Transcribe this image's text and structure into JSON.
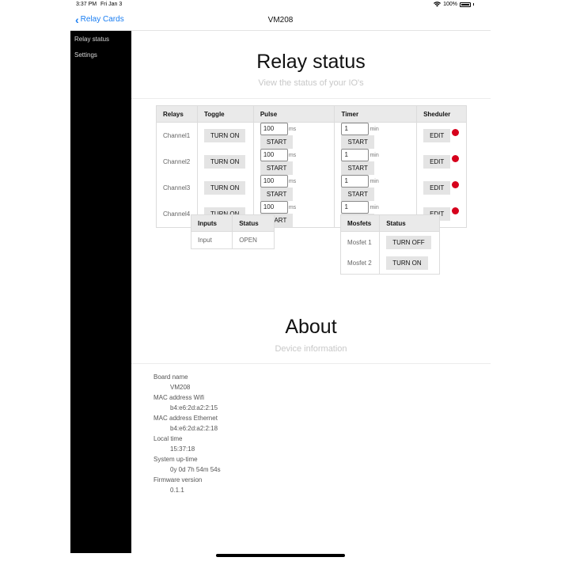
{
  "statusbar": {
    "time": "3:37 PM",
    "date": "Fri Jan 3",
    "battery": "100%"
  },
  "nav": {
    "back_label": "Relay Cards",
    "title": "VM208"
  },
  "sidebar": {
    "items": [
      {
        "label": "Relay status"
      },
      {
        "label": "Settings"
      }
    ]
  },
  "relay_section": {
    "title": "Relay status",
    "subtitle": "View the status of your IO's"
  },
  "relay_table": {
    "headers": [
      "Relays",
      "Toggle",
      "Pulse",
      "Timer",
      "Sheduler"
    ],
    "pulse_unit": "ms",
    "timer_unit": "min",
    "start_label": "START",
    "edit_label": "EDIT",
    "rows": [
      {
        "name": "Channel1",
        "toggle": "TURN ON",
        "pulse": "100",
        "timer": "1"
      },
      {
        "name": "Channel2",
        "toggle": "TURN ON",
        "pulse": "100",
        "timer": "1"
      },
      {
        "name": "Channel3",
        "toggle": "TURN ON",
        "pulse": "100",
        "timer": "1"
      },
      {
        "name": "Channel4",
        "toggle": "TURN ON",
        "pulse": "100",
        "timer": "1"
      }
    ],
    "scheduler_status_color": "#d6001c"
  },
  "inputs_table": {
    "headers": [
      "Inputs",
      "Status"
    ],
    "rows": [
      {
        "name": "Input",
        "status": "OPEN"
      }
    ]
  },
  "mosfets_table": {
    "headers": [
      "Mosfets",
      "Status"
    ],
    "rows": [
      {
        "name": "Mosfet 1",
        "action": "TURN OFF"
      },
      {
        "name": "Mosfet 2",
        "action": "TURN ON"
      }
    ]
  },
  "about_section": {
    "title": "About",
    "subtitle": "Device information",
    "items": [
      {
        "label": "Board name",
        "value": "VM208"
      },
      {
        "label": "MAC address Wifi",
        "value": "b4:e6:2d:a2:2:15"
      },
      {
        "label": "MAC address Ethernet",
        "value": "b4:e6:2d:a2:2:18"
      },
      {
        "label": "Local time",
        "value": "15:37:18"
      },
      {
        "label": "System up-time",
        "value": "0y 0d 7h 54m 54s"
      },
      {
        "label": "Firmware version",
        "value": "0.1.1"
      }
    ]
  },
  "colors": {
    "accent": "#1a7ef2",
    "sidebar_bg": "#000000"
  }
}
